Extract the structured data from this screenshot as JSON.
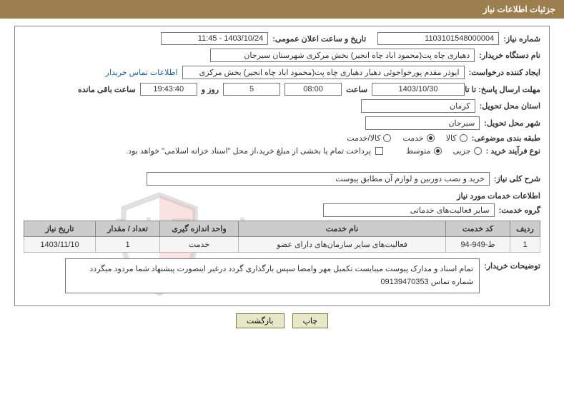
{
  "header": {
    "title": "جزئیات اطلاعات نیاز"
  },
  "fields": {
    "need_no_label": "شماره نیاز:",
    "need_no": "1103101548000004",
    "announce_label": "تاریخ و ساعت اعلان عمومی:",
    "announce_value": "1403/10/24 - 11:45",
    "buyer_org_label": "نام دستگاه خریدار:",
    "buyer_org": "دهیاری چاه پت(محمود اباد چاه انجیر) بخش مرکزی شهرستان سیرجان",
    "requester_label": "ایجاد کننده درخواست:",
    "requester": "ایوذر مقدم پورخواجوئی دهیار دهیاری چاه پت(محمود اباد چاه انجیر) بخش مرکزی",
    "contact_link": "اطلاعات تماس خریدار",
    "deadline_label": "مهلت ارسال پاسخ: تا تاریخ:",
    "deadline_date": "1403/10/30",
    "time_label": "ساعت",
    "deadline_time": "08:00",
    "days_value": "5",
    "days_suffix": "روز و",
    "remaining_time": "19:43:40",
    "remaining_suffix": "ساعت باقی مانده",
    "province_label": "استان محل تحویل:",
    "province": "کرمان",
    "city_label": "شهر محل تحویل:",
    "city": "سیرجان",
    "category_label": "طبقه بندی موضوعی:",
    "cat_goods": "کالا",
    "cat_service": "خدمت",
    "cat_goods_service": "کالا/خدمت",
    "purchase_type_label": "نوع فرآیند خرید :",
    "type_partial": "جزیی",
    "type_medium": "متوسط",
    "payment_note": "پرداخت تمام یا بخشی از مبلغ خرید،از محل \"اسناد خزانه اسلامی\" خواهد بود.",
    "overall_desc_label": "شرح کلی نیاز:",
    "overall_desc": "خرید و نصب دوربین و لوازم آن مطابق پیوست",
    "services_header": "اطلاعات خدمات مورد نیاز",
    "service_group_label": "گروه خدمت:",
    "service_group": "سایر فعالیت‌های خدماتی",
    "buyer_notes_label": "توضیحات خریدار:",
    "buyer_notes": "تمام اسناد و مدارک پیوست میبایست تکمیل مهر وامضا سپس بارگذاری گردد درغیر اینصورت پیشنهاد شما مردود میگردد شماره تماس 09139470353"
  },
  "table": {
    "headers": {
      "row": "ردیف",
      "code": "کد خدمت",
      "name": "نام خدمت",
      "unit": "واحد اندازه گیری",
      "qty": "تعداد / مقدار",
      "date": "تاریخ نیاز"
    },
    "rows": [
      {
        "row": "1",
        "code": "ط-949-94",
        "name": "فعالیت‌های سایر سازمان‌های دارای عضو",
        "unit": "خدمت",
        "qty": "1",
        "date": "1403/11/10"
      }
    ]
  },
  "buttons": {
    "print": "چاپ",
    "back": "بازگشت"
  },
  "watermark": "AriaTender.net"
}
